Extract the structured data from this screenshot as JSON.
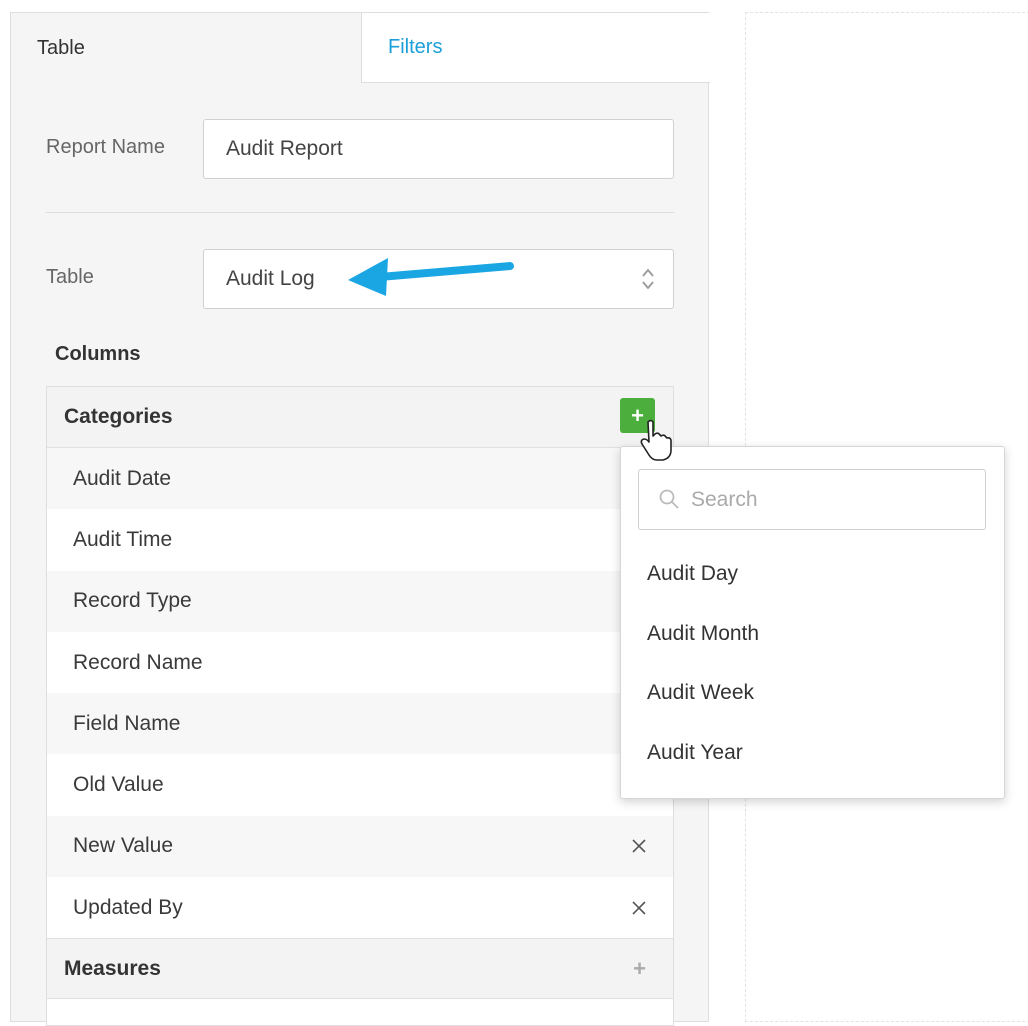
{
  "tabs": {
    "table": "Table",
    "filters": "Filters"
  },
  "form": {
    "report_name_label": "Report Name",
    "report_name_value": "Audit Report",
    "table_label": "Table",
    "table_value": "Audit Log"
  },
  "columns": {
    "title": "Columns",
    "categories": {
      "title": "Categories",
      "add_label": "+",
      "items": [
        "Audit Date",
        "Audit Time",
        "Record Type",
        "Record Name",
        "Field Name",
        "Old Value",
        "New Value",
        "Updated By"
      ]
    },
    "measures": {
      "title": "Measures",
      "add_label": "+"
    }
  },
  "dropdown": {
    "search_placeholder": "Search",
    "options": [
      "Audit Day",
      "Audit Month",
      "Audit Week",
      "Audit Year"
    ]
  },
  "colors": {
    "accent": "#1a9fd8",
    "add_button": "#4cae3c",
    "annotation_arrow": "#1aa6e3"
  },
  "icons": [
    "search-icon",
    "close-icon",
    "plus-icon",
    "hand-cursor-icon",
    "chevron-updown-icon",
    "annotation-arrow"
  ]
}
